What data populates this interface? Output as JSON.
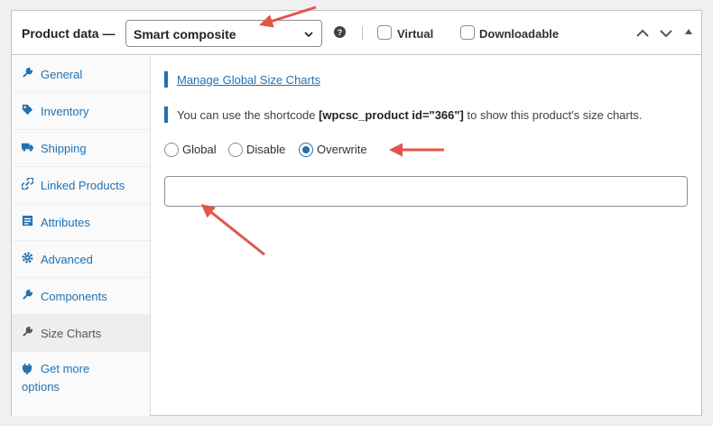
{
  "header": {
    "title": "Product data —",
    "product_type": "Smart composite",
    "help_glyph": "?",
    "virtual_label": "Virtual",
    "downloadable_label": "Downloadable"
  },
  "sidebar": {
    "items": [
      {
        "label": "General",
        "icon": "wrench-icon"
      },
      {
        "label": "Inventory",
        "icon": "tag-icon"
      },
      {
        "label": "Shipping",
        "icon": "truck-icon"
      },
      {
        "label": "Linked Products",
        "icon": "link-icon"
      },
      {
        "label": "Attributes",
        "icon": "list-icon"
      },
      {
        "label": "Advanced",
        "icon": "gear-icon"
      },
      {
        "label": "Components",
        "icon": "wrench-icon"
      },
      {
        "label": "Size Charts",
        "icon": "wrench-icon",
        "active": true
      },
      {
        "label": "Get more options",
        "icon": "plug-icon"
      }
    ]
  },
  "content": {
    "manage_link": "Manage Global Size Charts",
    "notice_prefix": "You can use the shortcode ",
    "shortcode": "[wpcsc_product id=\"366\"]",
    "notice_suffix": " to show this product's size charts.",
    "radio_options": [
      "Global",
      "Disable",
      "Overwrite"
    ],
    "selected_option": "Overwrite",
    "input_value": ""
  },
  "colors": {
    "accent": "#2271b1",
    "annotation_arrow": "#e2554a"
  }
}
